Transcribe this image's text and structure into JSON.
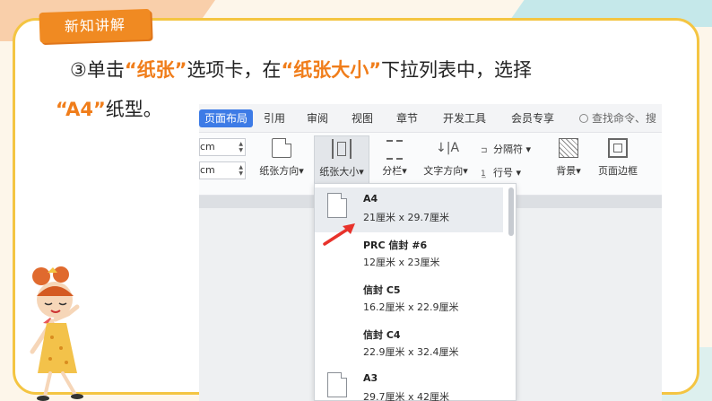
{
  "section_tag": "新知讲解",
  "instruction": {
    "line1_prefix": "③单击",
    "line1_hl1": "“纸张”",
    "line1_mid": "选项卡，在",
    "line1_hl2": "“纸张大小”",
    "line1_suffix": "下拉列表中，选择",
    "line2_hl": "“A4”",
    "line2_suffix": "纸型。"
  },
  "app": {
    "tabs": [
      {
        "label": "页面布局",
        "active": true
      },
      {
        "label": "引用"
      },
      {
        "label": "审阅"
      },
      {
        "label": "视图"
      },
      {
        "label": "章节"
      },
      {
        "label": "开发工具"
      },
      {
        "label": "会员专享"
      },
      {
        "label": "查找命令、搜"
      }
    ],
    "spinners": [
      "cm",
      "cm"
    ],
    "ribbon": {
      "orientation": "纸张方向",
      "size": "纸张大小",
      "columns": "分栏",
      "text_direction": "文字方向",
      "separator": "分隔符",
      "line_numbers": "行号",
      "background": "背景",
      "page_border": "页面边框"
    },
    "paper_sizes": [
      {
        "name": "A4",
        "dims": "21厘米  x  29.7厘米",
        "selected": true
      },
      {
        "name": "PRC 信封 #6",
        "dims": "12厘米  x  23厘米"
      },
      {
        "name": "信封 C5",
        "dims": "16.2厘米  x  22.9厘米"
      },
      {
        "name": "信封 C4",
        "dims": "22.9厘米  x  32.4厘米"
      },
      {
        "name": "A3",
        "dims": "29.7厘米  x  42厘米"
      }
    ]
  },
  "colors": {
    "accent": "#f07d1a",
    "frame": "#f4c542",
    "active_tab": "#3d7be6",
    "arrow": "#e8322b"
  }
}
